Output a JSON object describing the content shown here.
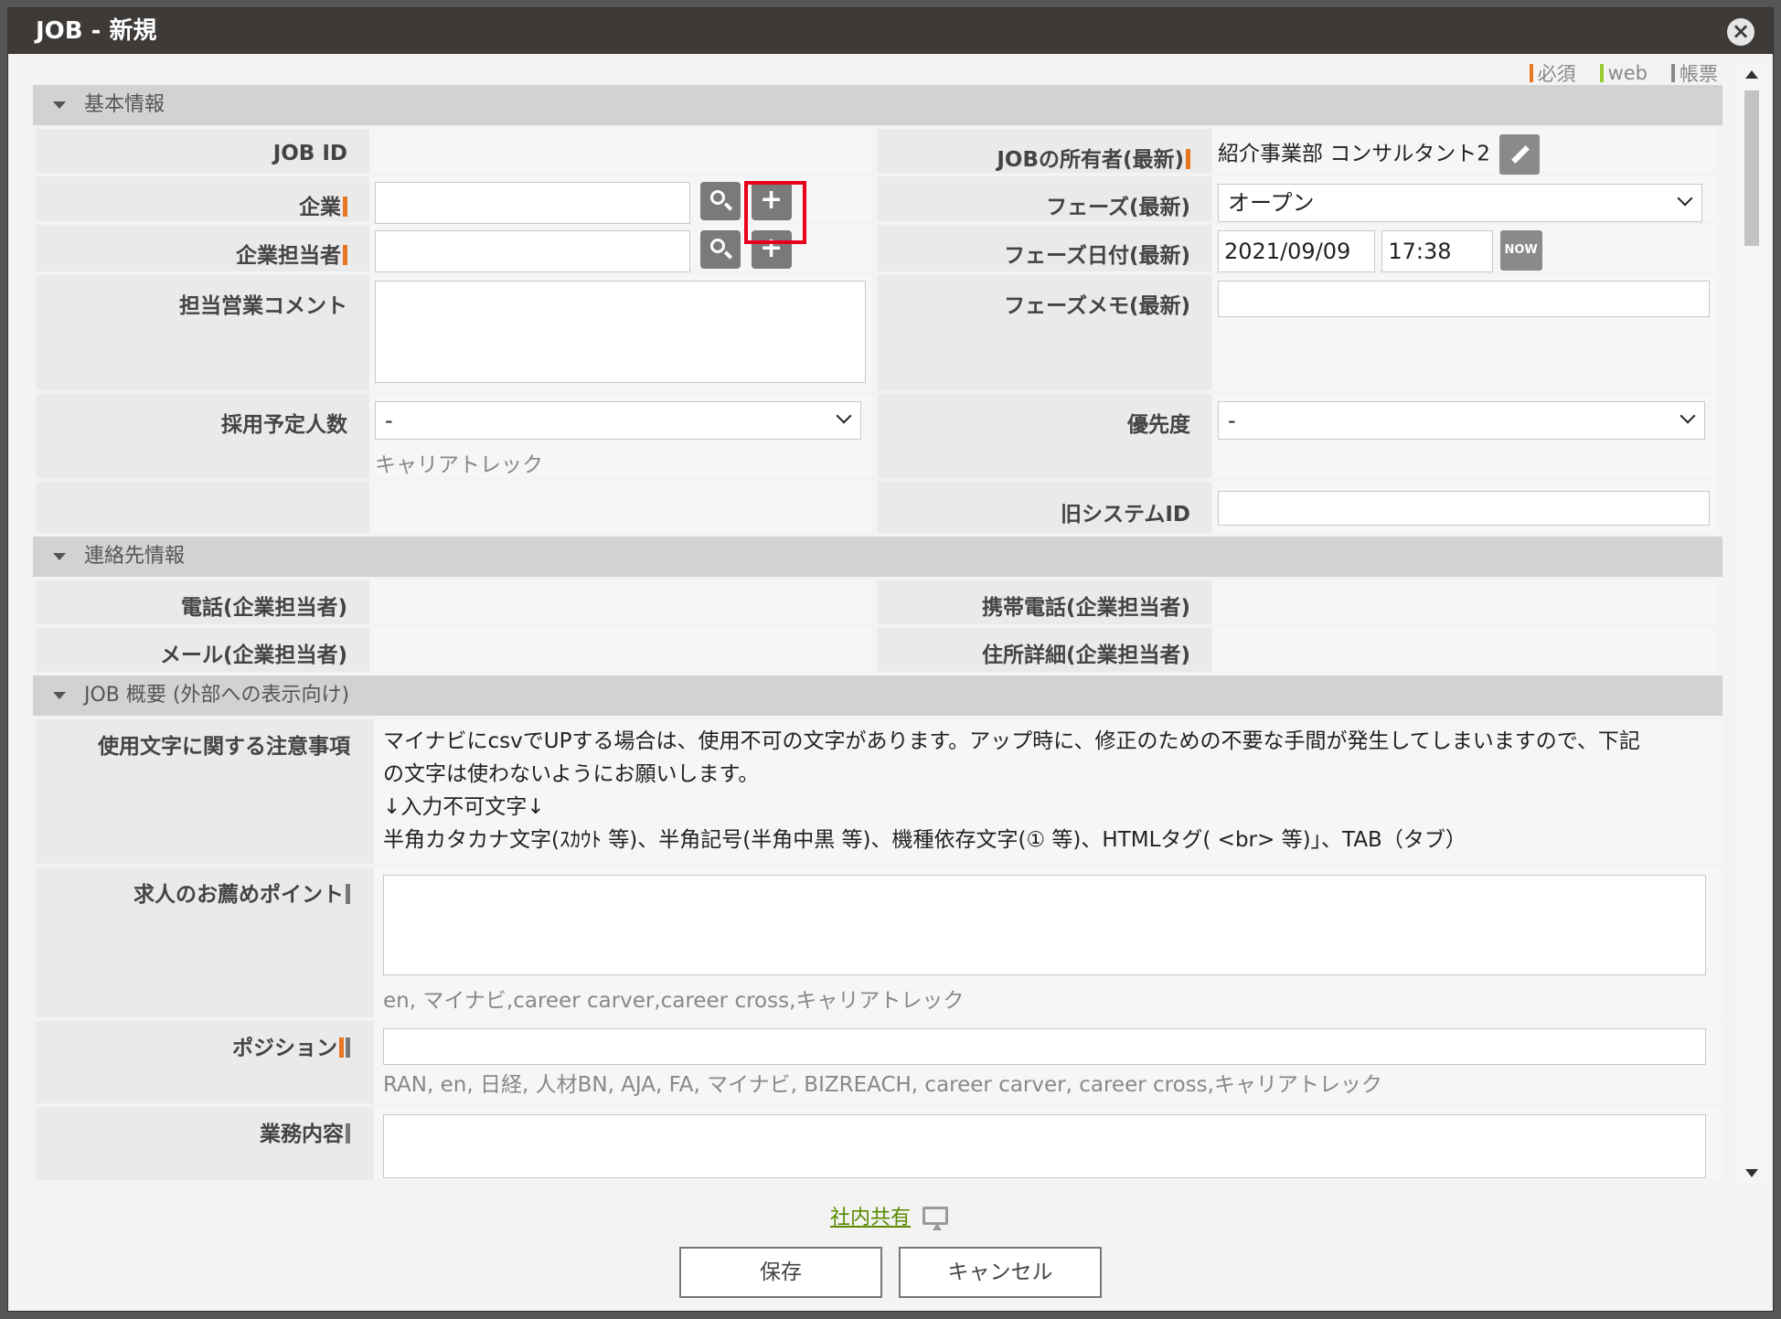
{
  "window": {
    "title": "JOB - 新規",
    "close": "×"
  },
  "legend": [
    {
      "label": "必須",
      "color": "#e87722"
    },
    {
      "label": "web",
      "color": "#9acd32"
    },
    {
      "label": "帳票",
      "color": "#888888"
    }
  ],
  "sections": {
    "basic": "基本情報",
    "contact": "連絡先情報",
    "summary": "JOB 概要 (外部への表示向け)"
  },
  "basic": {
    "job_id_label": "JOB ID",
    "owner_label": "JOBの所有者(最新)",
    "owner_value": "紹介事業部 コンサルタント2",
    "company_label": "企業",
    "phase_label": "フェーズ(最新)",
    "phase_value": "オープン",
    "contact_label": "企業担当者",
    "phase_date_label": "フェーズ日付(最新)",
    "phase_date": "2021/09/09",
    "phase_time": "17:38",
    "now": "NOW",
    "sales_comment_label": "担当営業コメント",
    "phase_memo_label": "フェーズメモ(最新)",
    "hires_label": "採用予定人数",
    "hires_value": "-",
    "hires_hint": "キャリアトレック",
    "priority_label": "優先度",
    "priority_value": "-",
    "legacy_id_label": "旧システムID"
  },
  "contact": {
    "phone_label": "電話(企業担当者)",
    "mobile_label": "携帯電話(企業担当者)",
    "mail_label": "メール(企業担当者)",
    "address_label": "住所詳細(企業担当者)"
  },
  "summary": {
    "caution_label": "使用文字に関する注意事項",
    "caution_line1": "マイナビにcsvでUPする場合は、使用不可の文字があります。アップ時に、修正のための不要な手間が発生してしまいますので、下記",
    "caution_line2": "の文字は使わないようにお願いします。",
    "caution_line3": "↓入力不可文字↓",
    "caution_line4": "半角カタカナ文字(ｽｶｳﾄ 等)、半角記号(半角中黒 等)、機種依存文字(① 等)、HTMLタグ( <br> 等)」、TAB（タブ）",
    "points_label": "求人のお薦めポイント",
    "points_hint": "en, マイナビ,career carver,career cross,キャリアトレック",
    "position_label": "ポジション",
    "position_hint": "RAN, en, 日経, 人材BN, AJA, FA, マイナビ, BIZREACH, career carver, career cross,キャリアトレック",
    "duties_label": "業務内容"
  },
  "footer": {
    "share_link": "社内共有",
    "save": "保存",
    "cancel": "キャンセル"
  }
}
